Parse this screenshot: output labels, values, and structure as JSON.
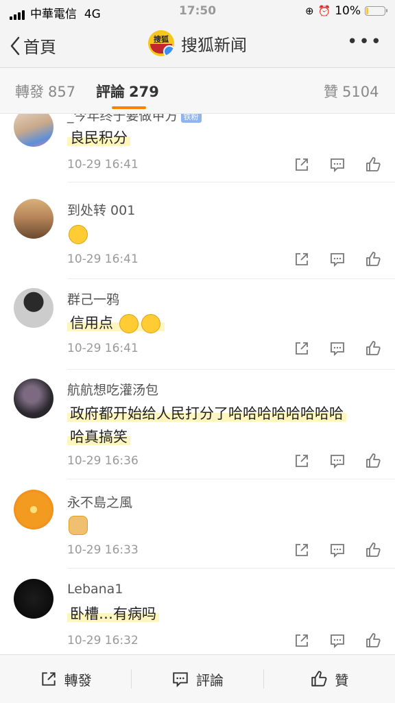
{
  "status": {
    "carrier": "中華電信",
    "network": "4G",
    "time": "17:50",
    "battery": "10%",
    "battery_level": 0.1
  },
  "nav": {
    "back_label": "首頁",
    "title": "搜狐新闻",
    "logo_text": "搜狐",
    "more": "•••"
  },
  "tabs": [
    {
      "label": "轉發",
      "count": "857"
    },
    {
      "label": "評論",
      "count": "279"
    },
    {
      "label": "贊",
      "count": "5104"
    }
  ],
  "comments": [
    {
      "user": "_今年终于要做甲方",
      "badge": "铁粉",
      "text": "良民积分",
      "time": "10-29 16:41"
    },
    {
      "user": "到处转 001",
      "text": "",
      "time": "10-29 16:41"
    },
    {
      "user": "群己一鸦",
      "text": "信用点",
      "time": "10-29 16:41"
    },
    {
      "user": "航航想吃灌汤包",
      "text": "政府都开始给人民打分了哈哈哈哈哈哈哈哈",
      "text2": "哈真搞笑",
      "time": "10-29 16:36"
    },
    {
      "user": "永不島之風",
      "text": "",
      "time": "10-29 16:33"
    },
    {
      "user": "Lebana1",
      "text": "卧槽…有病吗",
      "time": "10-29 16:32"
    }
  ],
  "bottom": {
    "repost": "轉發",
    "comment": "評論",
    "like": "贊"
  }
}
